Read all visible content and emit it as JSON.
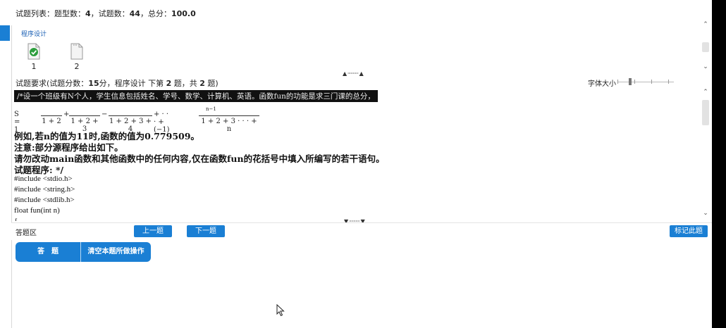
{
  "header": {
    "list_prefix": "试题列表：题型数：",
    "type_count": "4",
    "question_count_label": "，试题数：",
    "question_count": "44",
    "total_label": "，总分：",
    "total_score": "100.0"
  },
  "category": {
    "label": "程序设计"
  },
  "questions": [
    {
      "number": "1",
      "icon": "document-checked-icon"
    },
    {
      "number": "2",
      "icon": "document-icon"
    }
  ],
  "requirement": {
    "prefix": "试题要求(试题分数：",
    "score": "15",
    "middle": "分，程序设计 下第",
    "index": "2",
    "middle2": "题，共",
    "total": "2",
    "suffix": "题)"
  },
  "font_control": {
    "label": "字体大小"
  },
  "problem": {
    "first_line": "/*设一个班级有N个人，学生信息包括姓名、学号、数学、计算机、英语。函数fun的功能是求三门课的总分，",
    "formula": {
      "lead": "S = 1 −",
      "t1_den": "1 + 2",
      "op1": "+",
      "t2_den": "1 + 2 + 3",
      "op2": "−",
      "t3_den": "1 + 2 + 3 + 4",
      "op3": "+ · · · + (−1)",
      "exp": "n−1",
      "t4_den": "1 + 2 + 3 · · · + n"
    },
    "lines": [
      "例如,若n的值为11时,函数的值为0.779509。",
      "注意:部分源程序给出如下。",
      "请勿改动main函数和其他函数中的任何内容,仅在函数fun的花括号中填入所编写的若干语句。",
      "试题程序: */"
    ],
    "code": [
      "#include <stdio.h>",
      "#include <string.h>",
      "#include <stdlib.h>",
      "float fun(int  n)",
      "{"
    ]
  },
  "answer_area": {
    "label": "答题区",
    "prev_label": "上一题",
    "next_label": "下一题",
    "mark_label": "标记此题",
    "answer_label": "答　题",
    "clear_label": "清空本题所做操作"
  },
  "colors": {
    "accent": "#1a7fd4",
    "side_bar": "#000000"
  }
}
